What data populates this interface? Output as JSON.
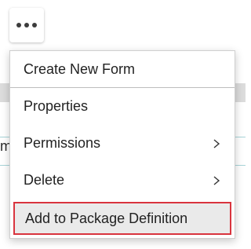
{
  "trigger": {
    "icon": "more-horizontal-icon"
  },
  "menu": {
    "items": [
      {
        "label": "Create New Form",
        "has_submenu": false
      },
      {
        "label": "Properties",
        "has_submenu": false
      },
      {
        "label": "Permissions",
        "has_submenu": true
      },
      {
        "label": "Delete",
        "has_submenu": true
      },
      {
        "label": "Add to Package Definition",
        "has_submenu": false,
        "highlighted": true
      }
    ]
  },
  "background": {
    "fragment_text": "m"
  },
  "colors": {
    "highlight_border": "#d9343e",
    "highlight_fill": "#eaeaea",
    "accent_line": "#a8d4d8"
  }
}
